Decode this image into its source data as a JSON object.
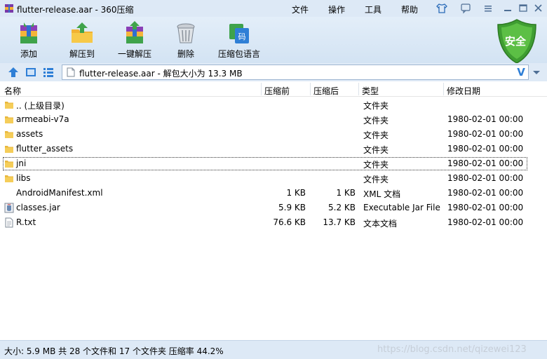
{
  "window": {
    "title": "flutter-release.aar - 360压缩",
    "menu": [
      "文件",
      "操作",
      "工具",
      "帮助"
    ]
  },
  "toolbar": {
    "add": "添加",
    "extract_to": "解压到",
    "one_click_extract": "一键解压",
    "delete": "删除",
    "archive_language": "压缩包语言",
    "shield_label": "安全"
  },
  "address": {
    "path": "flutter-release.aar - 解包大小为 13.3 MB",
    "v_glyph": "V"
  },
  "columns": {
    "name": "名称",
    "before": "压缩前",
    "after": "压缩后",
    "type": "类型",
    "date": "修改日期"
  },
  "files": [
    {
      "name": ".. (上级目录)",
      "before": "",
      "after": "",
      "type": "文件夹",
      "date": "",
      "icon": "folder-icon"
    },
    {
      "name": "armeabi-v7a",
      "before": "",
      "after": "",
      "type": "文件夹",
      "date": "1980-02-01 00:00",
      "icon": "folder-icon"
    },
    {
      "name": "assets",
      "before": "",
      "after": "",
      "type": "文件夹",
      "date": "1980-02-01 00:00",
      "icon": "folder-icon"
    },
    {
      "name": "flutter_assets",
      "before": "",
      "after": "",
      "type": "文件夹",
      "date": "1980-02-01 00:00",
      "icon": "folder-icon"
    },
    {
      "name": "jni",
      "before": "",
      "after": "",
      "type": "文件夹",
      "date": "1980-02-01 00:00",
      "icon": "folder-icon",
      "focused": true
    },
    {
      "name": "libs",
      "before": "",
      "after": "",
      "type": "文件夹",
      "date": "1980-02-01 00:00",
      "icon": "folder-icon"
    },
    {
      "name": "AndroidManifest.xml",
      "before": "1 KB",
      "after": "1 KB",
      "type": "XML 文档",
      "date": "1980-02-01 00:00",
      "icon": "blank-icon"
    },
    {
      "name": "classes.jar",
      "before": "5.9 KB",
      "after": "5.2 KB",
      "type": "Executable Jar File",
      "date": "1980-02-01 00:00",
      "icon": "jar-icon"
    },
    {
      "name": "R.txt",
      "before": "76.6 KB",
      "after": "13.7 KB",
      "type": "文本文档",
      "date": "1980-02-01 00:00",
      "icon": "text-file-icon"
    }
  ],
  "status": {
    "text": "大小: 5.9 MB 共 28 个文件和 17 个文件夹 压缩率 44.2%",
    "watermark": "https://blog.csdn.net/qizewei123"
  },
  "colors": {
    "titlebar": "#dde9f6",
    "toolbar": "#d8e6f5",
    "shield_green": "#4caf3c",
    "folder": "#f2c94c"
  }
}
